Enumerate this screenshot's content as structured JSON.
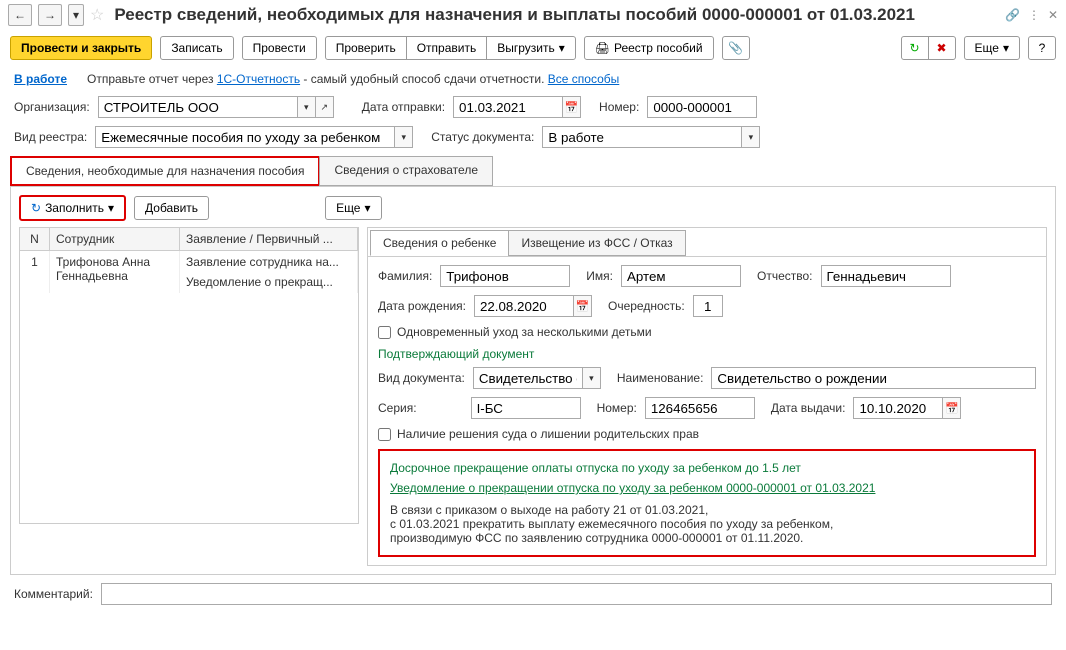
{
  "title": "Реестр сведений, необходимых для назначения и выплаты пособий 0000-000001 от 01.03.2021",
  "toolbar": {
    "post_close": "Провести и закрыть",
    "save": "Записать",
    "post": "Провести",
    "check": "Проверить",
    "send": "Отправить",
    "export": "Выгрузить",
    "registry": "Реестр пособий",
    "more": "Еще"
  },
  "status": {
    "label": "В работе",
    "hint_prefix": "Отправьте отчет через ",
    "hint_link": "1С-Отчетность",
    "hint_suffix": " - самый удобный способ сдачи отчетности. ",
    "all_methods": "Все способы"
  },
  "org": {
    "label": "Организация:",
    "value": "СТРОИТЕЛЬ ООО"
  },
  "send_date": {
    "label": "Дата отправки:",
    "value": "01.03.2021"
  },
  "number": {
    "label": "Номер:",
    "value": "0000-000001"
  },
  "reg_type": {
    "label": "Вид реестра:",
    "value": "Ежемесячные пособия по уходу за ребенком"
  },
  "doc_status": {
    "label": "Статус документа:",
    "value": "В работе"
  },
  "tabs": {
    "t1": "Сведения, необходимые для назначения пособия",
    "t2": "Сведения о страхователе"
  },
  "inner": {
    "fill": "Заполнить",
    "add": "Добавить",
    "more": "Еще"
  },
  "grid": {
    "h1": "N",
    "h2": "Сотрудник",
    "h3": "Заявление / Первичный ...",
    "rows": [
      {
        "n": "1",
        "emp": "Трифонова Анна Геннадьевна",
        "stmt1": "Заявление сотрудника на...",
        "stmt2": "Уведомление о прекращ..."
      }
    ]
  },
  "sub_tabs": {
    "t1": "Сведения о ребенке",
    "t2": "Извещение из ФСС / Отказ"
  },
  "child": {
    "lname_label": "Фамилия:",
    "lname": "Трифонов",
    "fname_label": "Имя:",
    "fname": "Артем",
    "mname_label": "Отчество:",
    "mname": "Геннадьевич",
    "bdate_label": "Дата рождения:",
    "bdate": "22.08.2020",
    "order_label": "Очередность:",
    "order": "1",
    "multi_label": "Одновременный уход за несколькими детьми"
  },
  "confirm_doc": {
    "title": "Подтверждающий документ",
    "type_label": "Вид документа:",
    "type": "Свидетельство о р",
    "name_label": "Наименование:",
    "name": "Свидетельство о рождении",
    "series_label": "Серия:",
    "series": "I-БС",
    "num_label": "Номер:",
    "num": "126465656",
    "issue_label": "Дата выдачи:",
    "issue": "10.10.2020",
    "court_label": "Наличие решения суда о лишении родительских прав"
  },
  "termination": {
    "title": "Досрочное прекращение оплаты отпуска по уходу за ребенком до 1.5 лет",
    "doc_link": "Уведомление о прекращении отпуска по уходу за ребенком 0000-000001 от 01.03.2021",
    "line1": "В связи с приказом о выходе на работу 21 от 01.03.2021,",
    "line2": "с 01.03.2021 прекратить выплату ежемесячного пособия по уходу за ребенком,",
    "line3": "производимую ФСС по заявлению сотрудника 0000-000001 от 01.11.2020."
  },
  "comment_label": "Комментарий:"
}
